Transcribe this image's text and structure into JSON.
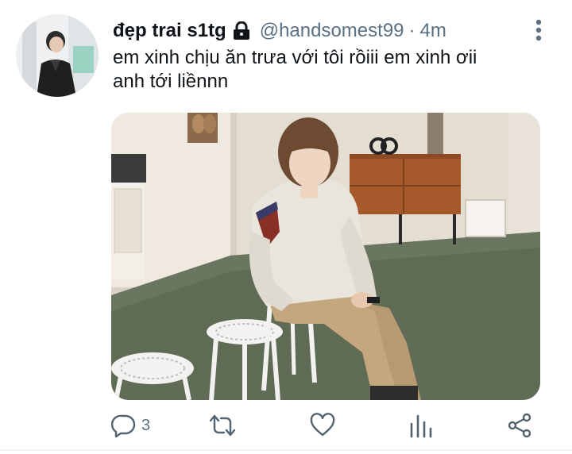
{
  "tweet": {
    "author": {
      "display_name": "đẹp trai s1tg",
      "handle": "@handsomest99",
      "protected": true,
      "avatar_icon": "avatar-photo"
    },
    "separator": "·",
    "timestamp": "4m",
    "text_lines": [
      "em xinh chịu ăn trưa với tôi rồiii em xinh ơii",
      "anh tới liềnnn"
    ],
    "media": {
      "kind": "photo"
    },
    "actions": {
      "reply_count": "3",
      "icons": [
        "reply-icon",
        "retweet-icon",
        "like-icon",
        "analytics-icon",
        "share-icon"
      ]
    }
  },
  "colors": {
    "text_primary": "#0f1419",
    "text_secondary": "#5b7083",
    "icon": "#536471",
    "background": "#ffffff"
  }
}
